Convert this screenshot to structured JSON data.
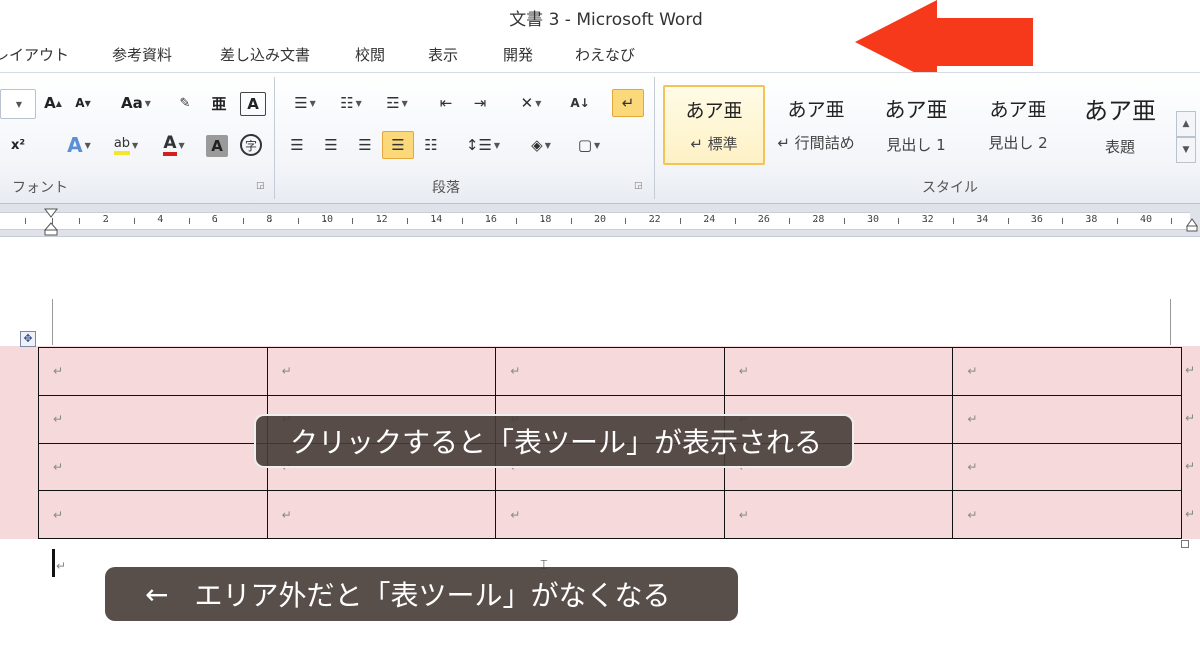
{
  "window": {
    "title": "文書 3 - Microsoft Word"
  },
  "tabs": [
    "レイアウト",
    "参考資料",
    "差し込み文書",
    "校閲",
    "表示",
    "開発",
    "わえなび"
  ],
  "ribbon": {
    "font_group_label": "フォント",
    "paragraph_group_label": "段落",
    "style_group_label": "スタイル",
    "font_buttons": {
      "grow": "A",
      "shrink": "A",
      "case": "Aa",
      "superscript": "x²",
      "char_shading": "A",
      "enclose": "字",
      "border": "A",
      "phonetic": "亜"
    },
    "styles": [
      {
        "sample": "あア亜",
        "name": "↵ 標準",
        "selected": true
      },
      {
        "sample": "あア亜",
        "name": "↵ 行間詰め",
        "selected": false
      },
      {
        "sample": "あア亜",
        "name": "見出し 1",
        "selected": false
      },
      {
        "sample": "あア亜",
        "name": "見出し 2",
        "selected": false
      },
      {
        "sample": "あア亜",
        "name": "表題",
        "selected": false
      }
    ]
  },
  "ruler": {
    "labels": [
      "2",
      "4",
      "6",
      "8",
      "10",
      "12",
      "14",
      "16",
      "18",
      "20",
      "22",
      "24",
      "26",
      "28",
      "30",
      "32",
      "34",
      "36",
      "38",
      "40"
    ]
  },
  "table": {
    "rows": 4,
    "cols": 5,
    "cell_mark": "↵"
  },
  "captions": {
    "inside": "クリックすると「表ツール」が表示される",
    "outside_arrow": "←",
    "outside": "エリア外だと「表ツール」がなくなる"
  },
  "colors": {
    "arrow": "#f5391a",
    "table_highlight": "#f6d9db",
    "caption_bg": "#46403a",
    "active_button": "#fbd87a"
  }
}
